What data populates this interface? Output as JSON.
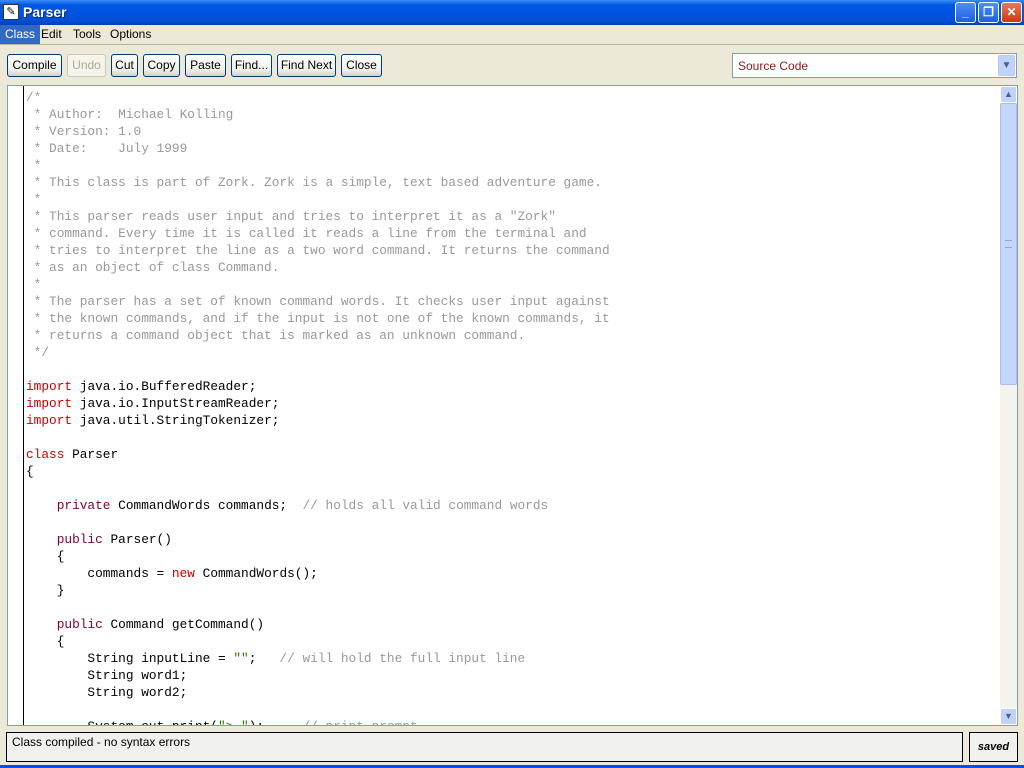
{
  "window": {
    "title": "Parser",
    "minimize": "_",
    "restore": "❐",
    "close": "✕"
  },
  "menu": [
    "Class",
    "Edit",
    "Tools",
    "Options"
  ],
  "toolbar": {
    "buttons": [
      {
        "label": "Compile",
        "enabled": true
      },
      {
        "label": "Undo",
        "enabled": false
      },
      {
        "label": "Cut",
        "enabled": true
      },
      {
        "label": "Copy",
        "enabled": true
      },
      {
        "label": "Paste",
        "enabled": true
      },
      {
        "label": "Find...",
        "enabled": true
      },
      {
        "label": "Find Next",
        "enabled": true
      },
      {
        "label": "Close",
        "enabled": true
      }
    ],
    "view_select": "Source Code"
  },
  "colors": {
    "comment": "#999999",
    "keyword": "#cc0000",
    "modifier": "#7f0033",
    "string": "#2a7a00"
  },
  "code": [
    [
      [
        "cm",
        "/*"
      ]
    ],
    [
      [
        "cm",
        " * Author:  Michael Kolling"
      ]
    ],
    [
      [
        "cm",
        " * Version: 1.0"
      ]
    ],
    [
      [
        "cm",
        " * Date:    July 1999"
      ]
    ],
    [
      [
        "cm",
        " *"
      ]
    ],
    [
      [
        "cm",
        " * This class is part of Zork. Zork is a simple, text based adventure game."
      ]
    ],
    [
      [
        "cm",
        " *"
      ]
    ],
    [
      [
        "cm",
        " * This parser reads user input and tries to interpret it as a \"Zork\""
      ]
    ],
    [
      [
        "cm",
        " * command. Every time it is called it reads a line from the terminal and"
      ]
    ],
    [
      [
        "cm",
        " * tries to interpret the line as a two word command. It returns the command"
      ]
    ],
    [
      [
        "cm",
        " * as an object of class Command."
      ]
    ],
    [
      [
        "cm",
        " *"
      ]
    ],
    [
      [
        "cm",
        " * The parser has a set of known command words. It checks user input against"
      ]
    ],
    [
      [
        "cm",
        " * the known commands, and if the input is not one of the known commands, it"
      ]
    ],
    [
      [
        "cm",
        " * returns a command object that is marked as an unknown command."
      ]
    ],
    [
      [
        "cm",
        " */"
      ]
    ],
    [],
    [
      [
        "k1",
        "import"
      ],
      [
        "",
        "java.io.BufferedReader;"
      ]
    ],
    [
      [
        "k1",
        "import"
      ],
      [
        "",
        "java.io.InputStreamReader;"
      ]
    ],
    [
      [
        "k1",
        "import"
      ],
      [
        "",
        "java.util.StringTokenizer;"
      ]
    ],
    [],
    [
      [
        "k1",
        "class"
      ],
      [
        "",
        "Parser"
      ]
    ],
    [
      [
        "",
        "{"
      ]
    ],
    [],
    [
      [
        "",
        "    "
      ],
      [
        "k2",
        "private"
      ],
      [
        "",
        " CommandWords commands;  "
      ],
      [
        "cm",
        "// holds all valid command words"
      ]
    ],
    [],
    [
      [
        "",
        "    "
      ],
      [
        "k2",
        "public"
      ],
      [
        "",
        " Parser()"
      ]
    ],
    [
      [
        "",
        "    {"
      ]
    ],
    [
      [
        "",
        "        commands = "
      ],
      [
        "k1",
        "new"
      ],
      [
        "",
        " CommandWords();"
      ]
    ],
    [
      [
        "",
        "    }"
      ]
    ],
    [],
    [
      [
        "",
        "    "
      ],
      [
        "k2",
        "public"
      ],
      [
        "",
        " Command getCommand()"
      ]
    ],
    [
      [
        "",
        "    {"
      ]
    ],
    [
      [
        "",
        "        String inputLine = "
      ],
      [
        "st",
        "\"\""
      ],
      [
        "",
        ";   "
      ],
      [
        "cm",
        "// will hold the full input line"
      ]
    ],
    [
      [
        "",
        "        String word1;"
      ]
    ],
    [
      [
        "",
        "        String word2;"
      ]
    ],
    [],
    [
      [
        "",
        "        System.out.print("
      ],
      [
        "st",
        "\"> \""
      ],
      [
        "",
        ");     "
      ],
      [
        "cm",
        "// print prompt"
      ]
    ]
  ],
  "status": {
    "message": "Class compiled - no syntax errors",
    "saved": "saved"
  },
  "scroll": {
    "thumb_start_fraction": 0.0,
    "visible_fraction": 0.47
  }
}
